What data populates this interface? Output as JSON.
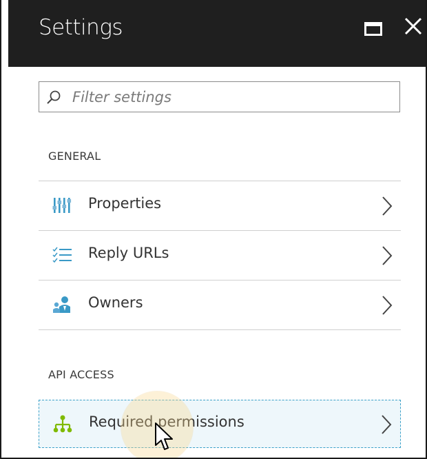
{
  "window": {
    "title": "Settings"
  },
  "filter": {
    "placeholder": "Filter settings",
    "value": ""
  },
  "sections": [
    {
      "label": "GENERAL",
      "items": [
        {
          "label": "Properties",
          "icon": "properties-icon"
        },
        {
          "label": "Reply URLs",
          "icon": "reply-urls-icon"
        },
        {
          "label": "Owners",
          "icon": "owners-icon"
        }
      ]
    },
    {
      "label": "API ACCESS",
      "items": [
        {
          "label": "Required permissions",
          "icon": "required-permissions-icon",
          "selected": true
        }
      ]
    }
  ],
  "colors": {
    "header_bg": "#1f1f1f",
    "accent_blue": "#3999c6",
    "permissions_green": "#7fba00",
    "selected_bg": "#eef7fb"
  }
}
